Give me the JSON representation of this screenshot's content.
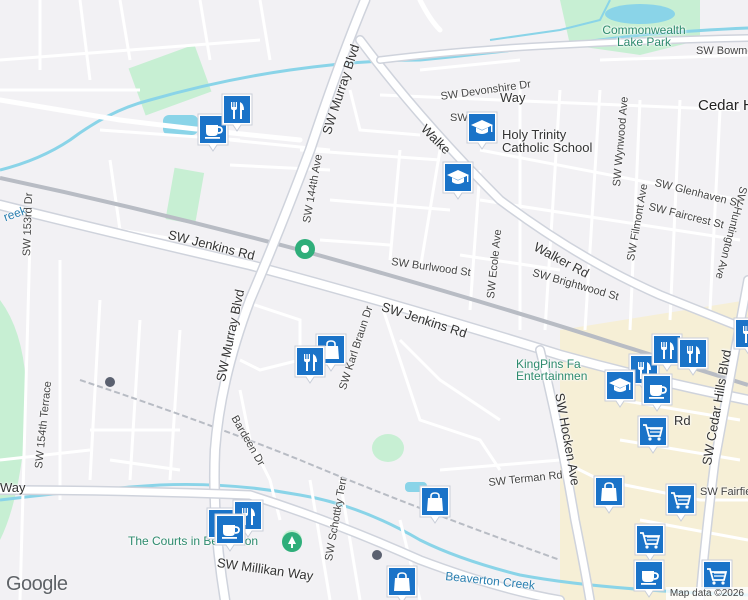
{
  "map": {
    "attribution": "Map data ©2026",
    "logo": "Google",
    "colors": {
      "background": "#f2f1f4",
      "road": "#ffffff",
      "road_edge": "#cfd3dc",
      "water": "#8ad4e8",
      "park": "#c7efd3",
      "retail": "#f6efd6",
      "rail": "#b8bcc4",
      "pin": "#1a73c8"
    },
    "labels": {
      "commonwealth_lake_park": "Commonwealth Lake Park",
      "sw_bowmont": "SW Bowmon",
      "sw_devonshire": "SW Devonshire Dr",
      "sw_way": "SW",
      "way": "Way",
      "cedar_hills": "Cedar H",
      "holy_trinity": "Holy Trinity Catholic School",
      "walker": "Walke",
      "walker_rd": "Walker Rd",
      "sw_murray_blvd_top": "SW Murray Blvd",
      "sw_144th": "SW 144th Ave",
      "sw_wynwood": "SW Wynwood Ave",
      "sw_huntington": "SW Huntington Ave",
      "sw_glenhaven": "SW Glenhaven St",
      "sw_faircrest": "SW Faircrest St",
      "sw_filmont": "SW Filmont Ave",
      "creek_left": "reek",
      "sw_153rd": "SW 153rd Dr",
      "sw_jenkins_left": "SW Jenkins Rd",
      "sw_jenkins_mid": "SW Jenkins Rd",
      "sw_burlwood": "SW Burlwood St",
      "sw_ecole": "SW Ecole Ave",
      "sw_brightwood": "SW Brightwood St",
      "sw_murray_blvd_low": "SW Murray Blvd",
      "sw_karl_braun": "SW Karl Braun Dr",
      "kingpins": "KingPins Fa Entertainmen",
      "sw_hocken": "SW Hocken Ave",
      "sw_cedar_hills_blvd": "SW Cedar Hills Blvd",
      "rd_right": "Rd",
      "sw_154th": "SW 154th Terrace",
      "bardeen": "Bardeen Dr",
      "sw_terman": "SW Terman Rd",
      "sw_fairfield": "SW Fairfiel",
      "way_left": "Way",
      "courts": "The Courts in Beaverton",
      "sw_millikan": "SW Millikan Way",
      "sw_schottky": "SW Schottky Terr",
      "beaverton_creek": "Beaverton Creek"
    },
    "pins": [
      {
        "id": "cafe-a",
        "icon": "coffee"
      },
      {
        "id": "restaurant-a",
        "icon": "restaurant"
      },
      {
        "id": "school-a",
        "icon": "school"
      },
      {
        "id": "school-b",
        "icon": "school"
      },
      {
        "id": "shopping-a",
        "icon": "shopping-bag"
      },
      {
        "id": "restaurant-b",
        "icon": "restaurant"
      },
      {
        "id": "shopping-b",
        "icon": "shopping-bag"
      },
      {
        "id": "restaurant-c",
        "icon": "restaurant"
      },
      {
        "id": "restaurant-d",
        "icon": "restaurant"
      },
      {
        "id": "cafe-b",
        "icon": "coffee"
      },
      {
        "id": "restaurant-e",
        "icon": "restaurant"
      },
      {
        "id": "school-c",
        "icon": "school"
      },
      {
        "id": "cafe-c",
        "icon": "coffee"
      },
      {
        "id": "cart-a",
        "icon": "shopping-cart"
      },
      {
        "id": "shopping-c",
        "icon": "shopping-bag"
      },
      {
        "id": "cart-b",
        "icon": "shopping-cart"
      },
      {
        "id": "cart-c",
        "icon": "shopping-cart"
      },
      {
        "id": "cafe-d",
        "icon": "coffee"
      },
      {
        "id": "restaurant-f",
        "icon": "restaurant"
      },
      {
        "id": "restaurant-g",
        "icon": "restaurant"
      },
      {
        "id": "restaurant-h",
        "icon": "restaurant"
      },
      {
        "id": "shopping-d",
        "icon": "shopping-bag"
      },
      {
        "id": "cart-d",
        "icon": "shopping-cart"
      }
    ]
  }
}
